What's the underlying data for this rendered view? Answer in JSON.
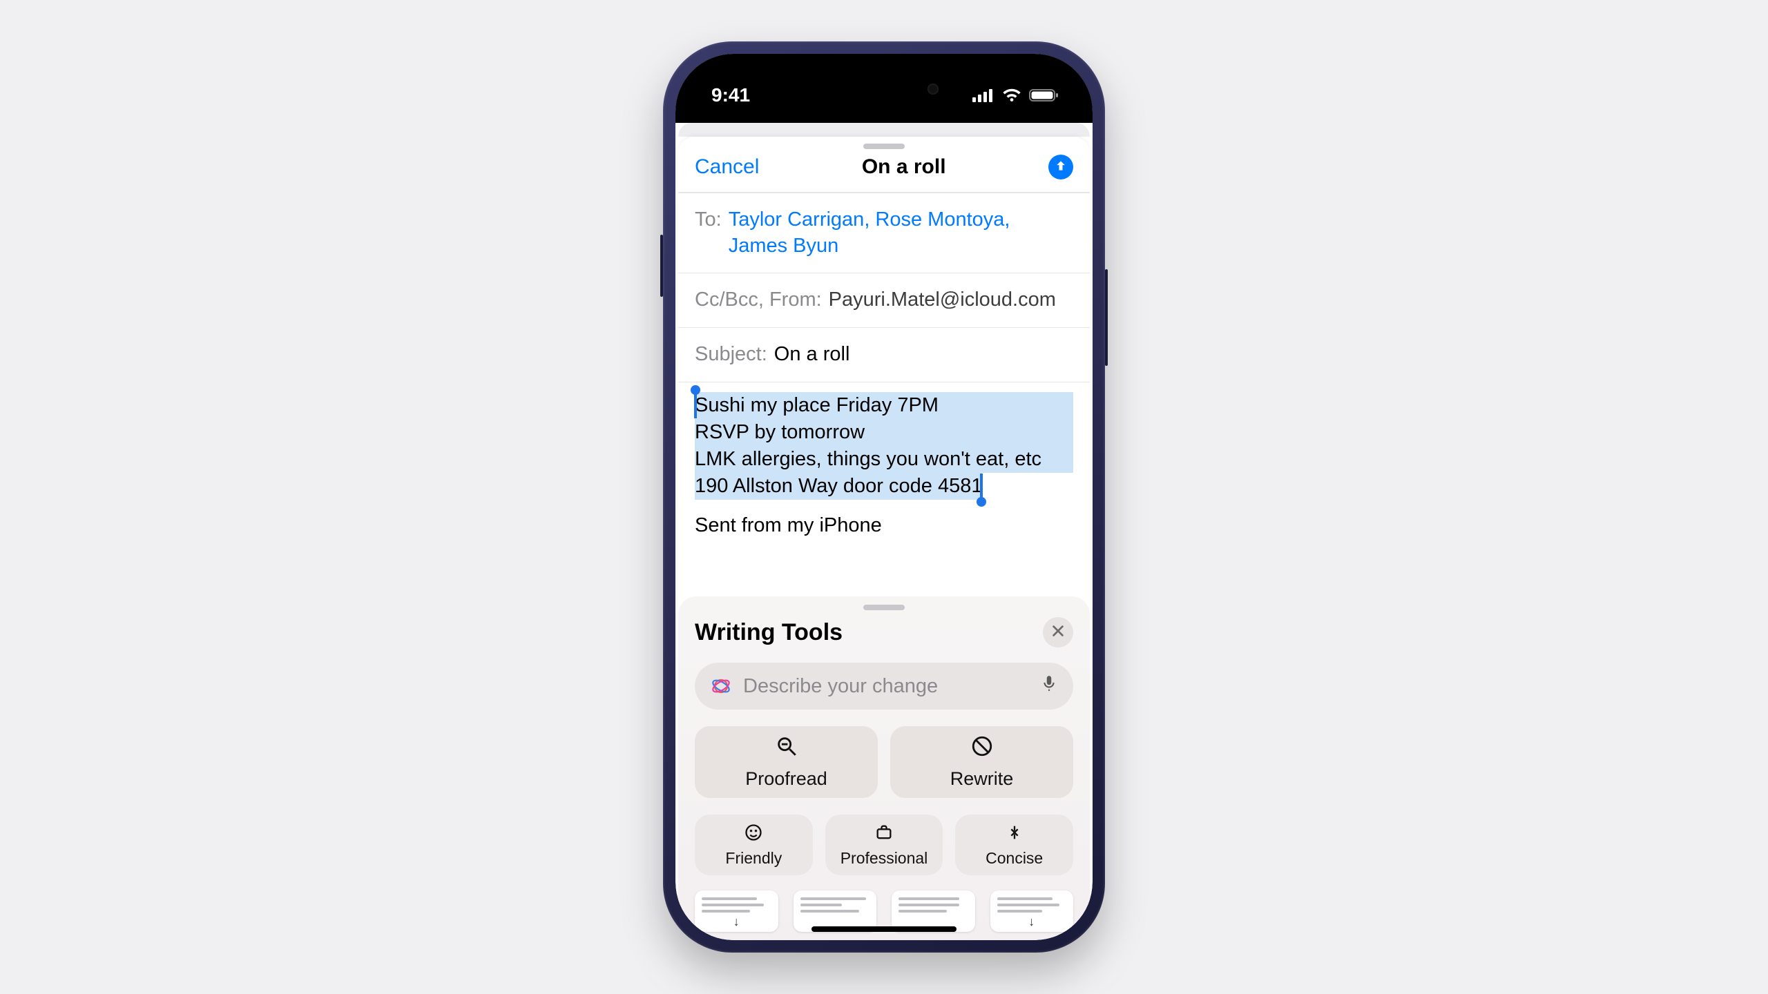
{
  "status": {
    "time": "9:41"
  },
  "compose": {
    "cancel": "Cancel",
    "title": "On a roll",
    "to_label": "To:",
    "to_value": "Taylor Carrigan, Rose Montoya, James Byun",
    "cc_label": "Cc/Bcc, From:",
    "from_value": "Payuri.Matel@icloud.com",
    "subject_label": "Subject:",
    "subject_value": "On a roll",
    "body_lines": [
      "Sushi my place Friday 7PM",
      "RSVP by tomorrow",
      "LMK allergies, things you won't eat, etc",
      "190 Allston Way door code 4581"
    ],
    "signature": "Sent from my iPhone"
  },
  "wt": {
    "title": "Writing Tools",
    "placeholder": "Describe your change",
    "actions": [
      {
        "id": "proofread",
        "label": "Proofread"
      },
      {
        "id": "rewrite",
        "label": "Rewrite"
      }
    ],
    "tones": [
      {
        "id": "friendly",
        "label": "Friendly"
      },
      {
        "id": "professional",
        "label": "Professional"
      },
      {
        "id": "concise",
        "label": "Concise"
      }
    ]
  }
}
